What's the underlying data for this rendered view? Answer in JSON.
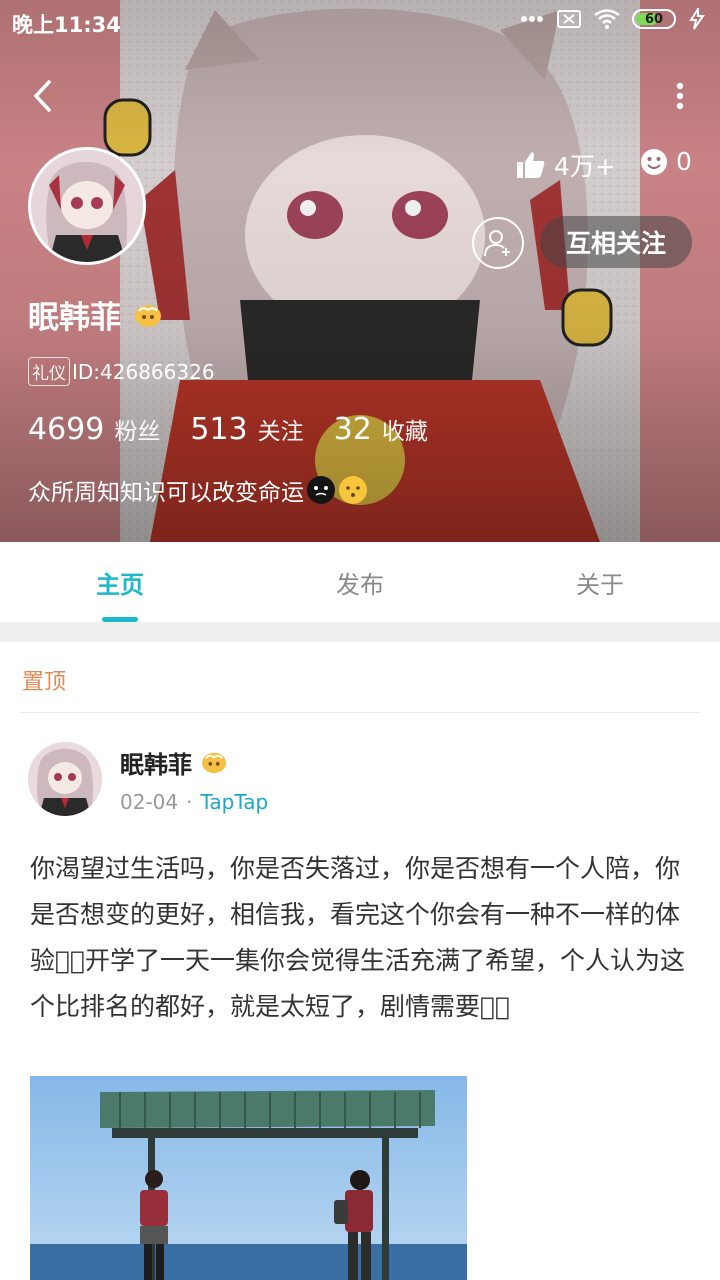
{
  "status_bar": {
    "time": "晚上11:34",
    "battery_level": "60",
    "battery_percent": 60,
    "icons": [
      "more-dots-icon",
      "sim-off-icon",
      "wifi-icon",
      "battery-icon",
      "charging-icon"
    ]
  },
  "profile": {
    "name": "眠韩菲",
    "id_tag": "礼仪",
    "id_text": "ID:426866326",
    "likes": "4万+",
    "mood_count": "0",
    "follow_button": "互相关注",
    "stats": {
      "fans_num": "4699",
      "fans_label": "粉丝",
      "following_num": "513",
      "following_label": "关注",
      "fav_num": "32",
      "fav_label": "收藏"
    },
    "bio": "众所周知知识可以改变命运"
  },
  "tabs": [
    {
      "label": "主页",
      "active": true
    },
    {
      "label": "发布",
      "active": false
    },
    {
      "label": "关于",
      "active": false
    }
  ],
  "pinned_label": "置顶",
  "post": {
    "author": "眠韩菲",
    "date": "02-04",
    "separator": "·",
    "source": "TapTap",
    "text": "你渴望过生活吗，你是否失落过，你是否想有一个人陪，你是否想变的更好，相信我，看完这个你会有一种不一样的体验􏰀􏰀开学了一天一集你会觉得生活充满了希望，个人认为这个比排名的都好，就是太短了，剧情需要􏰀􏰀"
  },
  "colors": {
    "accent": "#1ab8c9",
    "pinned": "#e08a56",
    "source_link": "#19a8c6"
  }
}
